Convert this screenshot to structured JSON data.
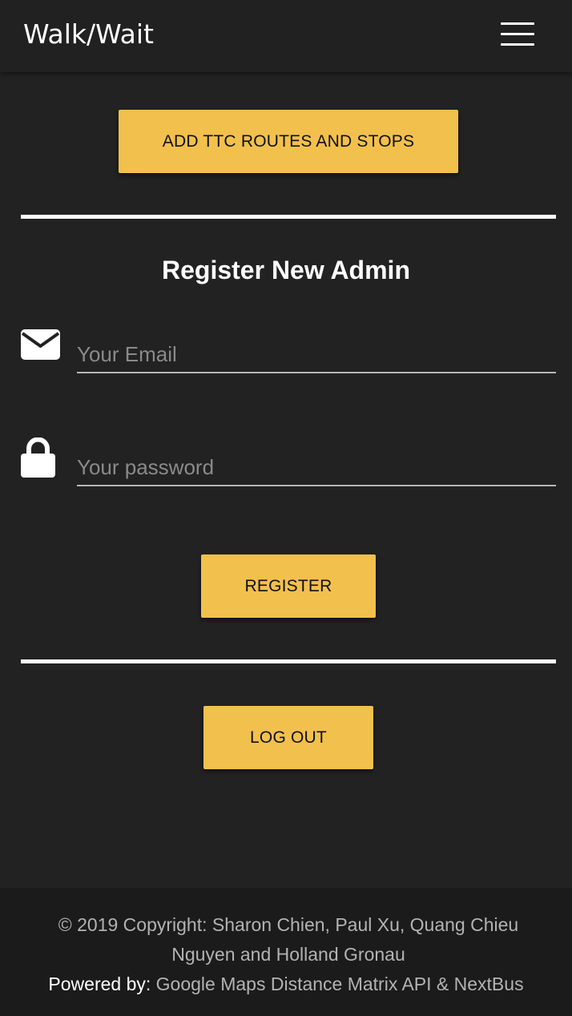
{
  "header": {
    "brand": "Walk/Wait",
    "menu_icon": "hamburger-menu-icon"
  },
  "main": {
    "add_routes_button": "ADD TTC ROUTES AND STOPS",
    "register_title": "Register New Admin",
    "email": {
      "icon": "envelope-icon",
      "placeholder": "Your Email",
      "value": ""
    },
    "password": {
      "icon": "lock-icon",
      "placeholder": "Your password",
      "value": ""
    },
    "register_button": "REGISTER",
    "logout_button": "LOG OUT"
  },
  "footer": {
    "copyright": "© 2019 Copyright: Sharon Chien, Paul Xu, Quang Chieu Nguyen and Holland Gronau",
    "powered_label": "Powered by:",
    "powered_links": "Google Maps Distance Matrix API & NextBus"
  },
  "colors": {
    "background": "#222222",
    "navbar": "#212121",
    "accent": "#f2c04d",
    "footer": "#1b1b1b"
  }
}
